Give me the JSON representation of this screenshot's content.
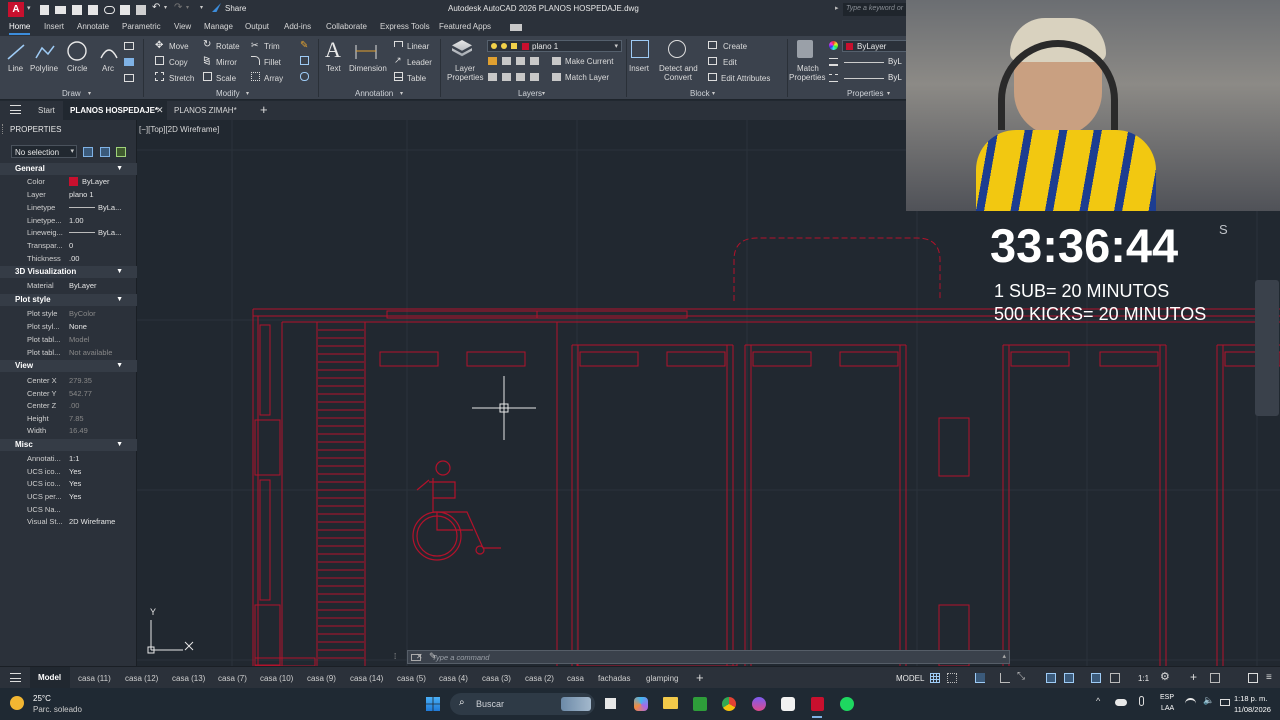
{
  "app": {
    "title": "Autodesk AutoCAD 2026   PLANOS HOSPEDAJE.dwg",
    "logo": "A",
    "share": "Share",
    "search_placeholder": "Type a keyword or"
  },
  "ribbon_tabs": [
    "Home",
    "Insert",
    "Annotate",
    "Parametric",
    "View",
    "Manage",
    "Output",
    "Add-ins",
    "Collaborate",
    "Express Tools",
    "Featured Apps"
  ],
  "ribbon": {
    "draw": {
      "line": "Line",
      "polyline": "Polyline",
      "circle": "Circle",
      "arc": "Arc",
      "title": "Draw"
    },
    "modify": {
      "move": "Move",
      "rotate": "Rotate",
      "trim": "Trim",
      "copy": "Copy",
      "mirror": "Mirror",
      "fillet": "Fillet",
      "stretch": "Stretch",
      "scale": "Scale",
      "array": "Array",
      "title": "Modify"
    },
    "annotation": {
      "text": "Text",
      "dimension": "Dimension",
      "linear": "Linear",
      "leader": "Leader",
      "table": "Table",
      "title": "Annotation"
    },
    "layers": {
      "layer_properties_1": "Layer",
      "layer_properties_2": "Properties",
      "current_layer": "plano 1",
      "make_current": "Make Current",
      "match_layer": "Match Layer",
      "title": "Layers"
    },
    "block": {
      "insert": "Insert",
      "detect_1": "Detect and",
      "detect_2": "Convert",
      "create": "Create",
      "edit": "Edit",
      "edit_attributes": "Edit Attributes",
      "title": "Block"
    },
    "properties": {
      "match_1": "Match",
      "match_2": "Properties",
      "bylayer": "ByLayer",
      "bylayer_short": "ByL",
      "title": "Properties"
    }
  },
  "file_tabs": {
    "start": "Start",
    "tab1": "PLANOS HOSPEDAJE*",
    "tab2": "PLANOS ZIMAH*"
  },
  "properties_panel": {
    "title": "PROPERTIES",
    "selection": "No selection",
    "general": {
      "title": "General",
      "rows": [
        {
          "k": "Color",
          "v": "ByLayer"
        },
        {
          "k": "Layer",
          "v": "plano 1"
        },
        {
          "k": "Linetype",
          "v": "ByLa..."
        },
        {
          "k": "Linetype...",
          "v": "1.00"
        },
        {
          "k": "Lineweig...",
          "v": "ByLa..."
        },
        {
          "k": "Transpar...",
          "v": "0"
        },
        {
          "k": "Thickness",
          "v": ".00"
        }
      ]
    },
    "viz": {
      "title": "3D Visualization",
      "rows": [
        {
          "k": "Material",
          "v": "ByLayer"
        }
      ]
    },
    "plot": {
      "title": "Plot style",
      "rows": [
        {
          "k": "Plot style",
          "v": "ByColor"
        },
        {
          "k": "Plot styl...",
          "v": "None"
        },
        {
          "k": "Plot tabl...",
          "v": "Model"
        },
        {
          "k": "Plot tabl...",
          "v": "Not available"
        }
      ]
    },
    "view": {
      "title": "View",
      "rows": [
        {
          "k": "Center X",
          "v": "279.35"
        },
        {
          "k": "Center Y",
          "v": "542.77"
        },
        {
          "k": "Center Z",
          "v": ".00"
        },
        {
          "k": "Height",
          "v": "7.85"
        },
        {
          "k": "Width",
          "v": "16.49"
        }
      ]
    },
    "misc": {
      "title": "Misc",
      "rows": [
        {
          "k": "Annotati...",
          "v": "1:1"
        },
        {
          "k": "UCS ico...",
          "v": "Yes"
        },
        {
          "k": "UCS ico...",
          "v": "Yes"
        },
        {
          "k": "UCS per...",
          "v": "Yes"
        },
        {
          "k": "UCS Na...",
          "v": ""
        },
        {
          "k": "Visual St...",
          "v": "2D Wireframe"
        }
      ]
    }
  },
  "viewport": {
    "label": "[−][Top][2D Wireframe]",
    "ucs_y": "Y"
  },
  "command_line": {
    "placeholder": "Type a command"
  },
  "overlay": {
    "timer": "33:36:44",
    "timer_suffix": "S",
    "line1": "1 SUB= 20 MINUTOS",
    "line2": "500 KICKS= 20 MINUTOS"
  },
  "layout_tabs": [
    "Model",
    "casa (11)",
    "casa (12)",
    "casa (13)",
    "casa (7)",
    "casa (10)",
    "casa (9)",
    "casa (14)",
    "casa (5)",
    "casa (4)",
    "casa (3)",
    "casa (2)",
    "casa",
    "fachadas",
    "glamping"
  ],
  "status": {
    "model": "MODEL",
    "scale": "1:1"
  },
  "taskbar": {
    "weather_temp": "25°C",
    "weather_desc": "Parc. soleado",
    "search": "Buscar",
    "lang1": "ESP",
    "lang2": "LAA",
    "time": "1:18 p. m.",
    "date": "11/08/2026"
  },
  "colors": {
    "accent": "#3c8ddc",
    "drawing": "#c8102e",
    "canvas": "#212830"
  }
}
